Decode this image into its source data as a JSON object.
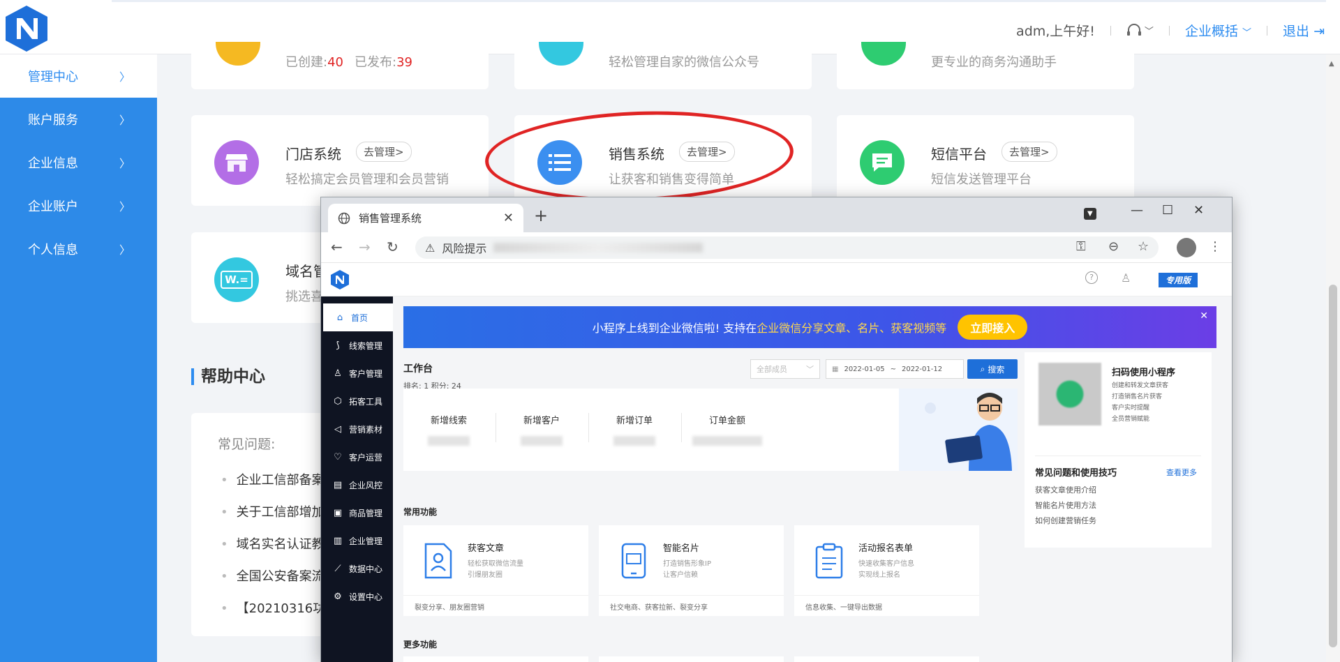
{
  "header": {
    "greeting": "adm,上午好!",
    "enterprise_label": "企业概括",
    "logout_label": "退出"
  },
  "sidebar": {
    "items": [
      {
        "label": "管理中心"
      },
      {
        "label": "账户服务"
      },
      {
        "label": "企业信息"
      },
      {
        "label": "企业账户"
      },
      {
        "label": "个人信息"
      }
    ]
  },
  "top_cards": {
    "card1_created_label": "已创建:",
    "card1_created_value": "40",
    "card1_published_label": "已发布:",
    "card1_published_value": "39",
    "card2_desc": "轻松管理自家的微信公众号",
    "card3_desc": "更专业的商务沟通助手"
  },
  "apps": [
    {
      "title": "门店系统",
      "manage": "去管理>",
      "desc": "轻松搞定会员管理和会员营销",
      "color": "#b36ee6"
    },
    {
      "title": "销售系统",
      "manage": "去管理>",
      "desc": "让获客和销售变得简单",
      "color": "#3b8ff0"
    },
    {
      "title": "短信平台",
      "manage": "去管理>",
      "desc": "短信发送管理平台",
      "color": "#2ecc71"
    },
    {
      "title": "域名管",
      "desc": "挑选喜",
      "color": "#33c8e0"
    }
  ],
  "help": {
    "title": "帮助中心",
    "faq_head": "常见问题:",
    "items": [
      "企业工信部备案",
      "关于工信部增加",
      "域名实名认证教",
      "全国公安备案流",
      "【20210316功能"
    ]
  },
  "browser": {
    "tab_title": "销售管理系统",
    "address_prefix": "风险提示",
    "vip_label": "专用版",
    "nav": [
      {
        "label": "首页",
        "icon": "home-icon"
      },
      {
        "label": "线索管理",
        "icon": "leads-icon"
      },
      {
        "label": "客户管理",
        "icon": "customers-icon"
      },
      {
        "label": "拓客工具",
        "icon": "tools-icon"
      },
      {
        "label": "营销素材",
        "icon": "megaphone-icon"
      },
      {
        "label": "客户运营",
        "icon": "operations-icon"
      },
      {
        "label": "企业风控",
        "icon": "risk-icon"
      },
      {
        "label": "商品管理",
        "icon": "goods-icon"
      },
      {
        "label": "企业管理",
        "icon": "enterprise-icon"
      },
      {
        "label": "数据中心",
        "icon": "chart-icon"
      },
      {
        "label": "设置中心",
        "icon": "settings-icon"
      }
    ],
    "banner": {
      "text_before": "小程序上线到企业微信啦!  支持在",
      "highlight": "企业微信分享文章、名片、获客视频等",
      "cta": "立即接入"
    },
    "workspace": {
      "title": "工作台",
      "rank": "排名: 1   积分: 24",
      "member_placeholder": "全部成员",
      "date_start": "2022-01-05",
      "date_sep": "~",
      "date_end": "2022-01-12",
      "search_label": "搜索"
    },
    "stats": [
      "新增线索",
      "新增客户",
      "新增订单",
      "订单金额"
    ],
    "qr": {
      "title": "扫码使用小程序",
      "lines": [
        "创建和转发文章获客",
        "打造销售名片获客",
        "客户实时提醒",
        "全员营销赋能"
      ]
    },
    "faq2": {
      "title": "常见问题和使用技巧",
      "more": "查看更多",
      "items": [
        "获客文章使用介绍",
        "智能名片使用方法",
        "如何创建营销任务"
      ]
    },
    "common_title": "常用功能",
    "more_title": "更多功能",
    "functions": [
      {
        "title": "获客文章",
        "d1": "轻松获取微信流量",
        "d2": "引爆朋友圈",
        "foot": "裂变分享、朋友圈营销"
      },
      {
        "title": "智能名片",
        "d1": "打造销售形象IP",
        "d2": "让客户信赖",
        "foot": "社交电商、获客拉新、裂变分享"
      },
      {
        "title": "活动报名表单",
        "d1": "快速收集客户信息",
        "d2": "实现线上报名",
        "foot": "信息收集、一键导出数据"
      }
    ]
  }
}
